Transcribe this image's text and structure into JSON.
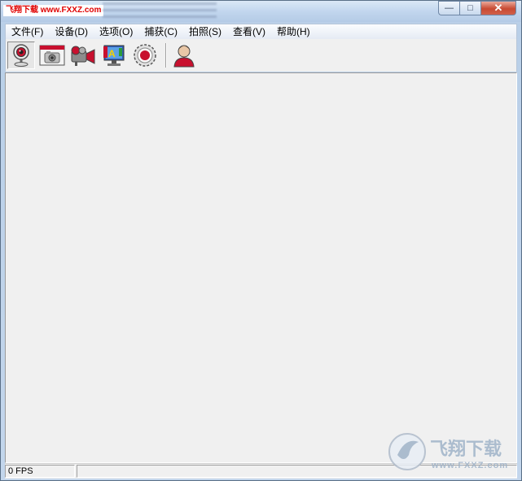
{
  "app": {
    "watermark": "飞翔下载 www.FXXZ.com"
  },
  "window_controls": {
    "minimize": "—",
    "maximize": "□",
    "close": "✕"
  },
  "menu": [
    {
      "label": "文件(F)"
    },
    {
      "label": "设备(D)"
    },
    {
      "label": "选项(O)"
    },
    {
      "label": "捕获(C)"
    },
    {
      "label": "拍照(S)"
    },
    {
      "label": "查看(V)"
    },
    {
      "label": "帮助(H)"
    }
  ],
  "toolbar": {
    "buttons": [
      {
        "icon": "webcam-icon",
        "pressed": true
      },
      {
        "icon": "camera-window-icon",
        "pressed": false
      },
      {
        "icon": "video-camera-icon",
        "pressed": false
      },
      {
        "icon": "monitor-paint-icon",
        "pressed": false
      },
      {
        "icon": "record-icon",
        "pressed": false
      },
      {
        "icon": "user-icon",
        "pressed": false
      }
    ]
  },
  "status": {
    "fps": "0 FPS",
    "message": ""
  },
  "logo": {
    "text_cn": "飞翔下载",
    "text_url": "www.FXXZ.com"
  },
  "colors": {
    "accent_red": "#c8102e",
    "close_button": "#c84a32",
    "background": "#f0f0f0"
  }
}
